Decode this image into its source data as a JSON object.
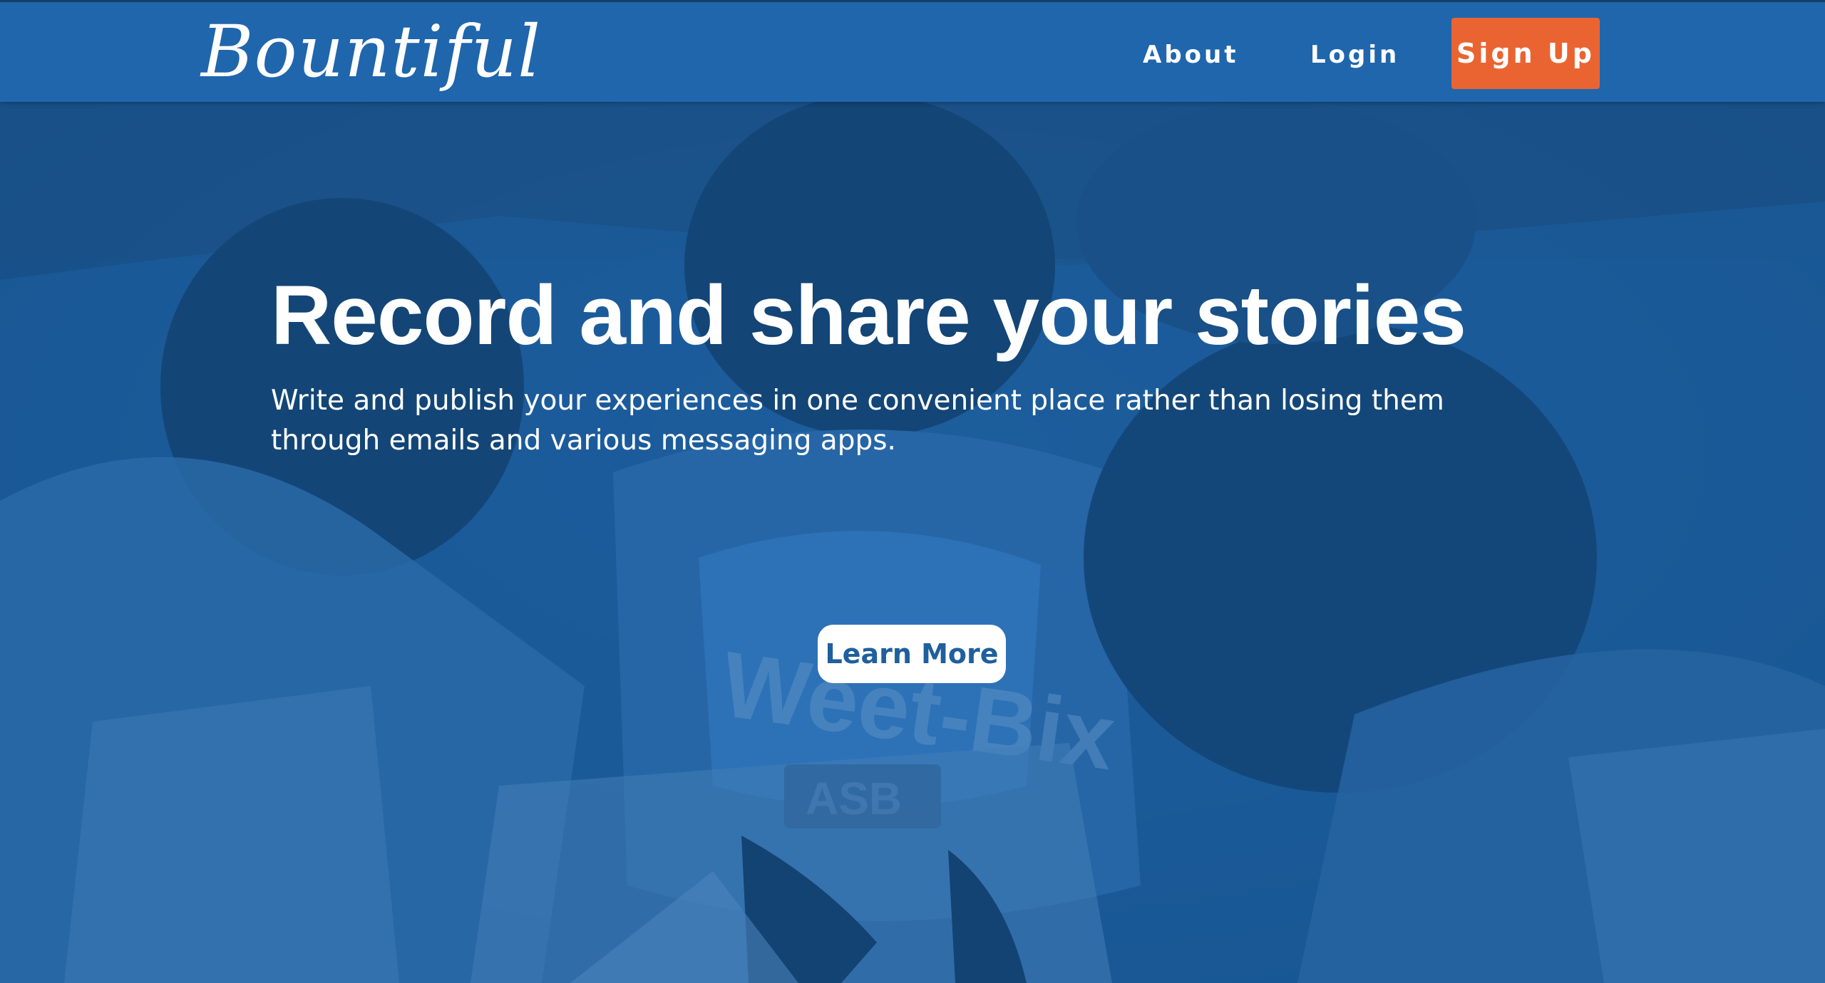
{
  "navbar": {
    "logo": "Bountiful",
    "about": "About",
    "login": "Login",
    "signup": "Sign Up"
  },
  "hero": {
    "title": "Record and share your stories",
    "subtitle": "Write and publish your experiences in one convenient place rather than losing them through emails and various messaging apps.",
    "cta": "Learn More",
    "background_image": "children-reading-photo"
  },
  "colors": {
    "navbar": "#1f66ad",
    "signup": "#ea6432",
    "hero_tint": "#1d5b96",
    "text": "#ffffff",
    "cta_text": "#1f5f9e"
  }
}
